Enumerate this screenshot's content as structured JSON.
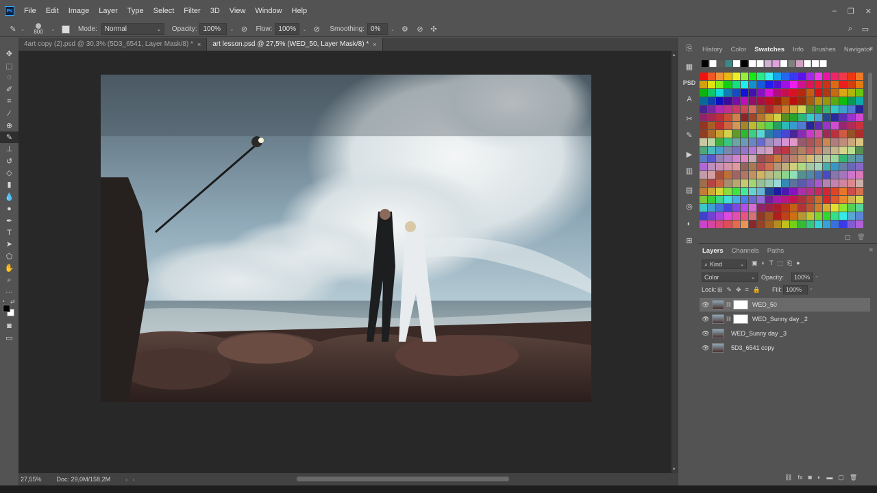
{
  "menubar": {
    "items": [
      "File",
      "Edit",
      "Image",
      "Layer",
      "Type",
      "Select",
      "Filter",
      "3D",
      "View",
      "Window",
      "Help"
    ]
  },
  "options": {
    "brush_size": "800",
    "mode_label": "Mode:",
    "mode_value": "Normal",
    "opacity_label": "Opacity:",
    "opacity_value": "100%",
    "flow_label": "Flow:",
    "flow_value": "100%",
    "smoothing_label": "Smoothing:",
    "smoothing_value": "0%"
  },
  "tabs": [
    {
      "label": "4art copy (2).psd @ 30,3% (5D3_6541, Layer Mask/8) *",
      "close": "×"
    },
    {
      "label": "art lesson.psd @ 27,5% (WED_50, Layer Mask/8) *",
      "close": "×"
    }
  ],
  "status": {
    "zoom": "27,55%",
    "doc": "Doc: 29,0M/158,2M"
  },
  "swatches_panel": {
    "tabs": [
      "History",
      "Color",
      "Swatches",
      "Info",
      "Brushes",
      "Navigator"
    ],
    "active_tab": "Swatches"
  },
  "layers_panel": {
    "tabs": [
      "Layers",
      "Channels",
      "Paths"
    ],
    "kind_label": "Kind",
    "blend_mode": "Color",
    "opacity_label": "Opacity:",
    "opacity_value": "100%",
    "lock_label": "Lock:",
    "fill_label": "Fill:",
    "fill_value": "100%",
    "layers": [
      {
        "name": "WED_50",
        "selected": true
      },
      {
        "name": "WED_Sunny day _2",
        "selected": false
      },
      {
        "name": "WED_Sunny day _3",
        "selected": false
      },
      {
        "name": "5D3_6541 copy",
        "selected": false
      }
    ]
  },
  "colors": {
    "accent": "#31a8ff",
    "canvas_bg": "#282828",
    "panel_bg": "#535353"
  }
}
